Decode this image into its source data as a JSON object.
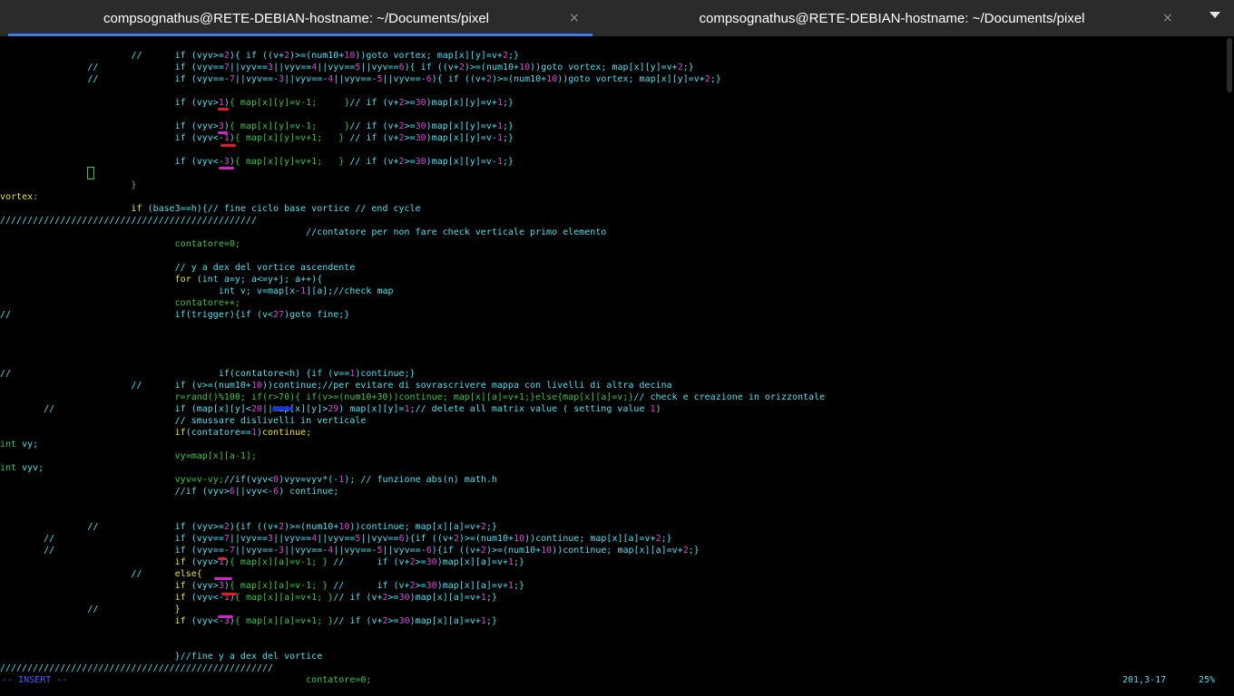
{
  "tabs": [
    {
      "title": "compsognathus@RETE-DEBIAN-hostname: ~/Documents/pixel",
      "active": true
    },
    {
      "title": "compsognathus@RETE-DEBIAN-hostname: ~/Documents/pixel",
      "active": false
    }
  ],
  "tab_close_glyph": "×",
  "colors": {
    "tab_bar": "#2b2b2b",
    "active_tab_underline": "#3d7ee0",
    "terminal_bg": "#000000",
    "code_default": "#4fe0f0",
    "number": "#e040e0",
    "green": "#3cc64a",
    "yellow": "#e7e728",
    "insert_mode": "#4a5cff",
    "annotation_red": "#e81a2a",
    "annotation_magenta": "#d424c8",
    "annotation_blue": "#2030e8"
  },
  "editor": {
    "lines": [
      [
        [
          "tk",
          "                        //      if (vyv>="
        ],
        [
          "num",
          "2"
        ],
        [
          "tk",
          "){ if ((v+"
        ],
        [
          "num",
          "2"
        ],
        [
          "tk",
          ")>=(num10+"
        ],
        [
          "num",
          "10"
        ],
        [
          "tk",
          "))goto vortex; map[x][y]=v+"
        ],
        [
          "num",
          "2"
        ],
        [
          "tk",
          ";}"
        ]
      ],
      [
        [
          "tk",
          "                //              if (vyv=="
        ],
        [
          "num",
          "7"
        ],
        [
          "tk",
          "||vyv=="
        ],
        [
          "num",
          "3"
        ],
        [
          "tk",
          "||vyv=="
        ],
        [
          "num",
          "4"
        ],
        [
          "tk",
          "||vyv=="
        ],
        [
          "num",
          "5"
        ],
        [
          "tk",
          "||vyv=="
        ],
        [
          "num",
          "6"
        ],
        [
          "tk",
          "){ if ((v+"
        ],
        [
          "num",
          "2"
        ],
        [
          "tk",
          ")>=(num10+"
        ],
        [
          "num",
          "10"
        ],
        [
          "tk",
          "))goto vortex; map[x][y]=v+"
        ],
        [
          "num",
          "2"
        ],
        [
          "tk",
          ";}"
        ]
      ],
      [
        [
          "tk",
          "                //              if (vyv==-"
        ],
        [
          "num",
          "7"
        ],
        [
          "tk",
          "||vyv==-"
        ],
        [
          "num",
          "3"
        ],
        [
          "tk",
          "||vyv==-"
        ],
        [
          "num",
          "4"
        ],
        [
          "tk",
          "||vyv==-"
        ],
        [
          "num",
          "5"
        ],
        [
          "tk",
          "||vyv==-"
        ],
        [
          "num",
          "6"
        ],
        [
          "tk",
          "){ if ((v+"
        ],
        [
          "num",
          "2"
        ],
        [
          "tk",
          ")>=(num10+"
        ],
        [
          "num",
          "10"
        ],
        [
          "tk",
          "))goto vortex; map[x][y]=v+"
        ],
        [
          "num",
          "2"
        ],
        [
          "tk",
          ";}"
        ]
      ],
      [
        [
          "tk",
          ""
        ]
      ],
      [
        [
          "tk",
          "                                if (vyv>"
        ],
        [
          "num",
          "1"
        ],
        [
          "tk",
          ")"
        ],
        [
          "grn",
          "{ map[x][y]=v-1;     }"
        ],
        [
          "tk",
          "// if (v+"
        ],
        [
          "num",
          "2"
        ],
        [
          "tk",
          ">="
        ],
        [
          "num",
          "30"
        ],
        [
          "tk",
          ")map[x][y]=v+"
        ],
        [
          "num",
          "1"
        ],
        [
          "tk",
          ";}"
        ]
      ],
      [
        [
          "tk",
          ""
        ]
      ],
      [
        [
          "tk",
          "                                if (vyv>"
        ],
        [
          "num",
          "3"
        ],
        [
          "tk",
          ")"
        ],
        [
          "grn",
          "{ map[x][y]=v-1;     }"
        ],
        [
          "tk",
          "// if (v+"
        ],
        [
          "num",
          "2"
        ],
        [
          "tk",
          ">="
        ],
        [
          "num",
          "30"
        ],
        [
          "tk",
          ")map[x][y]=v+"
        ],
        [
          "num",
          "1"
        ],
        [
          "tk",
          ";}"
        ]
      ],
      [
        [
          "tk",
          "                                if (vyv<-"
        ],
        [
          "num",
          "1"
        ],
        [
          "tk",
          ")"
        ],
        [
          "grn",
          "{ map[x][y]=v+1;   }"
        ],
        [
          "tk",
          " // if (v+"
        ],
        [
          "num",
          "2"
        ],
        [
          "tk",
          ">="
        ],
        [
          "num",
          "30"
        ],
        [
          "tk",
          ")map[x][y]=v-"
        ],
        [
          "num",
          "1"
        ],
        [
          "tk",
          ";}"
        ]
      ],
      [
        [
          "tk",
          ""
        ]
      ],
      [
        [
          "tk",
          "                                if (vyv<-"
        ],
        [
          "num",
          "3"
        ],
        [
          "tk",
          ")"
        ],
        [
          "grn",
          "{ map[x][y]=v+1;   }"
        ],
        [
          "tk",
          " // if (v+"
        ],
        [
          "num",
          "2"
        ],
        [
          "tk",
          ">="
        ],
        [
          "num",
          "30"
        ],
        [
          "tk",
          ")map[x][y]=v-"
        ],
        [
          "num",
          "1"
        ],
        [
          "tk",
          ";}"
        ]
      ],
      [
        [
          "tk",
          ""
        ]
      ],
      [
        [
          "tk",
          "                        "
        ],
        [
          "grn",
          "}"
        ]
      ],
      [
        [
          "yel",
          "vortex"
        ],
        [
          "tk",
          ":"
        ]
      ],
      [
        [
          "tk",
          "                        "
        ],
        [
          "yel",
          "if"
        ],
        [
          "tk",
          " (base3==h){// fine ciclo base vortice // end cycle"
        ]
      ],
      [
        [
          "tk",
          "///////////////////////////////////////////////"
        ]
      ],
      [
        [
          "tk",
          "                                                        //contatore per non fare check verticale primo elemento"
        ]
      ],
      [
        [
          "tk",
          "                                "
        ],
        [
          "grn",
          "contatore=0;"
        ]
      ],
      [
        [
          "tk",
          ""
        ]
      ],
      [
        [
          "tk",
          "                                // y a dex del vortice ascendente"
        ]
      ],
      [
        [
          "tk",
          "                                "
        ],
        [
          "yel",
          "for"
        ],
        [
          "tk",
          " (int a=y; a<=y+j; a++){"
        ]
      ],
      [
        [
          "tk",
          "                                        int v; v=map[x-"
        ],
        [
          "num",
          "1"
        ],
        [
          "tk",
          "][a];//check map"
        ]
      ],
      [
        [
          "tk",
          "                                "
        ],
        [
          "grn",
          "contatore++;"
        ]
      ],
      [
        [
          "tk",
          "//                              if(trigger){if (v<"
        ],
        [
          "num",
          "27"
        ],
        [
          "tk",
          ")goto fine;}"
        ]
      ],
      [
        [
          "tk",
          ""
        ]
      ],
      [
        [
          "tk",
          ""
        ]
      ],
      [
        [
          "tk",
          ""
        ]
      ],
      [
        [
          "tk",
          ""
        ]
      ],
      [
        [
          "tk",
          "//                                      if(contatore<h) {if (v=="
        ],
        [
          "num",
          "1"
        ],
        [
          "tk",
          ")continue;}"
        ]
      ],
      [
        [
          "tk",
          "                        //      if (v>=(num10+"
        ],
        [
          "num",
          "10"
        ],
        [
          "tk",
          "))continue;//per evitare di sovrascrivere mappa con livelli di altra decina"
        ]
      ],
      [
        [
          "grn",
          "                                r=rand()%100; if(r>70){ if(v>=(num10+30))continue; map[x][a]=v+1;}else{map[x][a]=v;}"
        ],
        [
          "tk",
          "// check e creazione in orizzontale"
        ]
      ],
      [
        [
          "tk",
          "        //                      if (map[x][y]<"
        ],
        [
          "num",
          "20"
        ],
        [
          "tk",
          "||map[x][y]>"
        ],
        [
          "num",
          "29"
        ],
        [
          "tk",
          ") map[x][y]="
        ],
        [
          "num",
          "1"
        ],
        [
          "tk",
          ";// delete all matrix value ( setting value "
        ],
        [
          "num",
          "1"
        ],
        [
          "tk",
          ")"
        ]
      ],
      [
        [
          "tk",
          "                                // smussare dislivelli in verticale"
        ]
      ],
      [
        [
          "tk",
          "                                "
        ],
        [
          "yel",
          "if"
        ],
        [
          "tk",
          "(contatore=="
        ],
        [
          "num",
          "1"
        ],
        [
          "tk",
          ")"
        ],
        [
          "yel",
          "continue"
        ],
        [
          "tk",
          ";"
        ]
      ],
      [
        [
          "grn",
          "int"
        ],
        [
          "tk",
          " vy;"
        ]
      ],
      [
        [
          "tk",
          "                                "
        ],
        [
          "grn",
          "vy=map[x][a-1];"
        ]
      ],
      [
        [
          "grn",
          "int"
        ],
        [
          "tk",
          " vyv;"
        ]
      ],
      [
        [
          "tk",
          "                                "
        ],
        [
          "grn",
          "vyv=v-vy;"
        ],
        [
          "tk",
          "//if(vyv<"
        ],
        [
          "num",
          "0"
        ],
        [
          "tk",
          ")vyv=vyv*(-"
        ],
        [
          "num",
          "1"
        ],
        [
          "tk",
          "); // funzione abs(n) math.h"
        ]
      ],
      [
        [
          "tk",
          "                                //if (vyv>"
        ],
        [
          "num",
          "6"
        ],
        [
          "tk",
          "||vyv<-"
        ],
        [
          "num",
          "6"
        ],
        [
          "tk",
          ") continue;"
        ]
      ],
      [
        [
          "tk",
          ""
        ]
      ],
      [
        [
          "tk",
          ""
        ]
      ],
      [
        [
          "tk",
          "                //              if (vyv>="
        ],
        [
          "num",
          "2"
        ],
        [
          "tk",
          "){if ((v+"
        ],
        [
          "num",
          "2"
        ],
        [
          "tk",
          ")>=(num10+"
        ],
        [
          "num",
          "10"
        ],
        [
          "tk",
          "))continue; map[x][a]=v+"
        ],
        [
          "num",
          "2"
        ],
        [
          "tk",
          ";}"
        ]
      ],
      [
        [
          "tk",
          "        //                      if (vyv=="
        ],
        [
          "num",
          "7"
        ],
        [
          "tk",
          "||vyv=="
        ],
        [
          "num",
          "3"
        ],
        [
          "tk",
          "||vyv=="
        ],
        [
          "num",
          "4"
        ],
        [
          "tk",
          "||vyv=="
        ],
        [
          "num",
          "5"
        ],
        [
          "tk",
          "||vyv=="
        ],
        [
          "num",
          "6"
        ],
        [
          "tk",
          "){if ((v+"
        ],
        [
          "num",
          "2"
        ],
        [
          "tk",
          ")>=(num10+"
        ],
        [
          "num",
          "10"
        ],
        [
          "tk",
          "))continue; map[x][a]=v+"
        ],
        [
          "num",
          "2"
        ],
        [
          "tk",
          ";}"
        ]
      ],
      [
        [
          "tk",
          "        //                      if (vyv==-"
        ],
        [
          "num",
          "7"
        ],
        [
          "tk",
          "||vyv==-"
        ],
        [
          "num",
          "3"
        ],
        [
          "tk",
          "||vyv==-"
        ],
        [
          "num",
          "4"
        ],
        [
          "tk",
          "||vyv==-"
        ],
        [
          "num",
          "5"
        ],
        [
          "tk",
          "||vyv==-"
        ],
        [
          "num",
          "6"
        ],
        [
          "tk",
          "){if ((v+"
        ],
        [
          "num",
          "2"
        ],
        [
          "tk",
          ")>=(num10+"
        ],
        [
          "num",
          "10"
        ],
        [
          "tk",
          "))continue; map[x][a]=v+"
        ],
        [
          "num",
          "2"
        ],
        [
          "tk",
          ";}"
        ]
      ],
      [
        [
          "tk",
          "                                "
        ],
        [
          "yel",
          "if"
        ],
        [
          "tk",
          " (vyv>"
        ],
        [
          "num",
          "1"
        ],
        [
          "tk",
          ")"
        ],
        [
          "grn",
          "{ map[x][a]=v-1; }"
        ],
        [
          "tk",
          " //      if (v+"
        ],
        [
          "num",
          "2"
        ],
        [
          "tk",
          ">="
        ],
        [
          "num",
          "30"
        ],
        [
          "tk",
          ")map[x][a]=v+"
        ],
        [
          "num",
          "1"
        ],
        [
          "tk",
          ";}"
        ]
      ],
      [
        [
          "tk",
          "                        //      "
        ],
        [
          "yel",
          "else{"
        ]
      ],
      [
        [
          "tk",
          "                                "
        ],
        [
          "yel",
          "if"
        ],
        [
          "tk",
          " (vyv>"
        ],
        [
          "num",
          "3"
        ],
        [
          "tk",
          ")"
        ],
        [
          "grn",
          "{ map[x][a]=v-1; }"
        ],
        [
          "tk",
          " //      if (v+"
        ],
        [
          "num",
          "2"
        ],
        [
          "tk",
          ">="
        ],
        [
          "num",
          "30"
        ],
        [
          "tk",
          ")map[x][a]=v+"
        ],
        [
          "num",
          "1"
        ],
        [
          "tk",
          ";}"
        ]
      ],
      [
        [
          "tk",
          "                                "
        ],
        [
          "yel",
          "if"
        ],
        [
          "tk",
          " (vyv<-"
        ],
        [
          "num",
          "1"
        ],
        [
          "tk",
          ")"
        ],
        [
          "grn",
          "{ map[x][a]=v+1; }"
        ],
        [
          "tk",
          "// if (v+"
        ],
        [
          "num",
          "2"
        ],
        [
          "tk",
          ">="
        ],
        [
          "num",
          "30"
        ],
        [
          "tk",
          ")map[x][a]=v+"
        ],
        [
          "num",
          "1"
        ],
        [
          "tk",
          ";}"
        ]
      ],
      [
        [
          "tk",
          "                //              "
        ],
        [
          "yel",
          "}"
        ]
      ],
      [
        [
          "tk",
          "                                "
        ],
        [
          "yel",
          "if"
        ],
        [
          "tk",
          " (vyv<-"
        ],
        [
          "num",
          "3"
        ],
        [
          "tk",
          ")"
        ],
        [
          "grn",
          "{ map[x][a]=v+1; }"
        ],
        [
          "tk",
          "// if (v+"
        ],
        [
          "num",
          "2"
        ],
        [
          "tk",
          ">="
        ],
        [
          "num",
          "30"
        ],
        [
          "tk",
          ")map[x][a]=v+"
        ],
        [
          "num",
          "1"
        ],
        [
          "tk",
          ";}"
        ]
      ],
      [
        [
          "tk",
          ""
        ]
      ],
      [
        [
          "tk",
          ""
        ]
      ],
      [
        [
          "tk",
          "                                }//fine y a dex del vortice"
        ]
      ],
      [
        [
          "tk",
          "//////////////////////////////////////////////////"
        ]
      ],
      [
        [
          "tk",
          "                                                        "
        ],
        [
          "grn",
          "contatore=0;"
        ]
      ]
    ]
  },
  "status": {
    "mode": "-- INSERT --",
    "position": "201,3-17",
    "percent": "25%"
  }
}
